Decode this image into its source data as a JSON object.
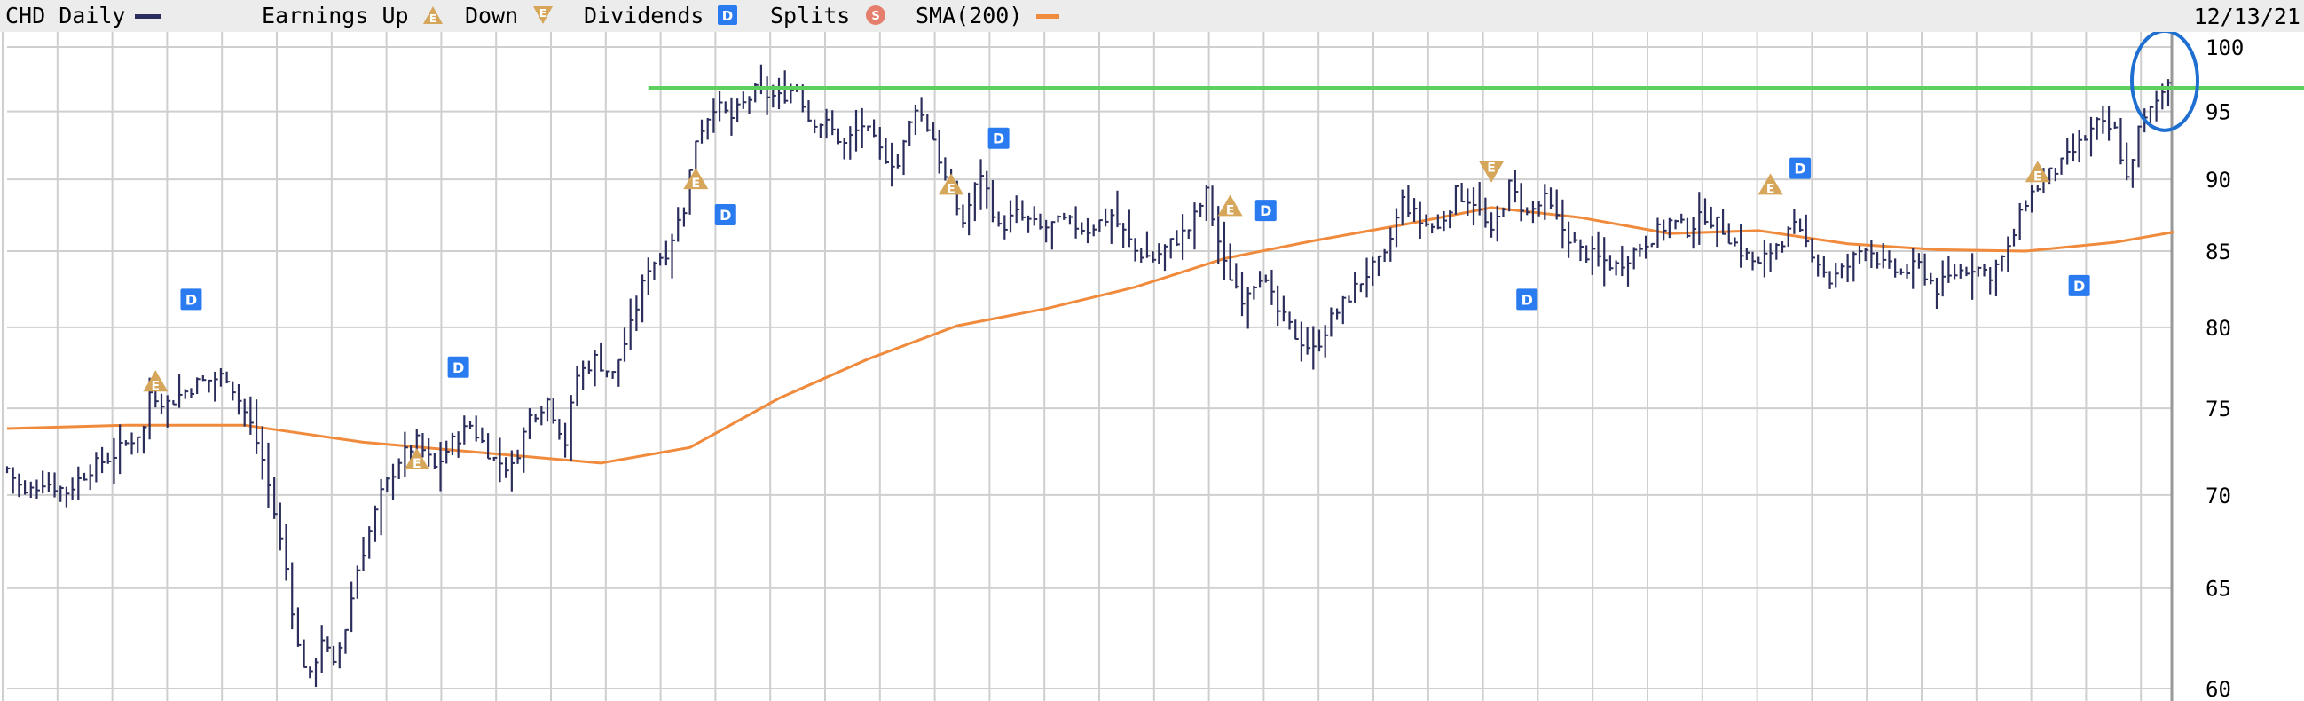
{
  "legend": {
    "symbol_label": "CHD Daily",
    "earnings_label": "Earnings Up",
    "earnings_up_glyph": "E",
    "down_label": "Down",
    "earnings_down_glyph": "E",
    "dividends_label": "Dividends",
    "dividend_glyph": "D",
    "splits_label": "Splits",
    "split_glyph": "S",
    "sma_label": "SMA(200)",
    "date": "12/13/21"
  },
  "colors": {
    "price": "#2b2e5c",
    "sma": "#f08a3c",
    "resistance": "#5ccf5c",
    "dividend": "#2a7bef",
    "earnings": "#d6a65a",
    "split": "#e57e6c",
    "highlight_circle": "#1f6fd0",
    "grid": "#cfcfcf"
  },
  "chart_data": {
    "type": "ohlc-bar",
    "symbol": "CHD",
    "interval": "Daily",
    "end_date": "12/13/21",
    "y_scale": "log",
    "ylim": [
      60,
      100
    ],
    "y_ticks": [
      "100",
      "95",
      "90",
      "85",
      "80",
      "75",
      "70",
      "65",
      "60"
    ],
    "grid": true,
    "price_path": [
      [
        0,
        71.5
      ],
      [
        3,
        70.0
      ],
      [
        6,
        70.8
      ],
      [
        10,
        70.2
      ],
      [
        14,
        71.5
      ],
      [
        18,
        72.3
      ],
      [
        23,
        73.8
      ],
      [
        24,
        76.0
      ],
      [
        27,
        75.3
      ],
      [
        32,
        76.5
      ],
      [
        37,
        77.0
      ],
      [
        41,
        74.0
      ],
      [
        43,
        72.0
      ],
      [
        45,
        69.0
      ],
      [
        47,
        66.0
      ],
      [
        49,
        62.0
      ],
      [
        51,
        60.5
      ],
      [
        53,
        62.5
      ],
      [
        55,
        61.0
      ],
      [
        57,
        63.0
      ],
      [
        59,
        66.0
      ],
      [
        61,
        68.0
      ],
      [
        63,
        70.0
      ],
      [
        66,
        72.0
      ],
      [
        69,
        73.0
      ],
      [
        72,
        71.5
      ],
      [
        75,
        73.0
      ],
      [
        78,
        74.0
      ],
      [
        82,
        72.0
      ],
      [
        85,
        71.5
      ],
      [
        88,
        74.5
      ],
      [
        91,
        75.5
      ],
      [
        94,
        73.0
      ],
      [
        96,
        77.0
      ],
      [
        99,
        78.0
      ],
      [
        102,
        77.0
      ],
      [
        105,
        80.0
      ],
      [
        108,
        84.0
      ],
      [
        111,
        85.0
      ],
      [
        114,
        88.0
      ],
      [
        116,
        93.0
      ],
      [
        119,
        95.5
      ],
      [
        122,
        94.5
      ],
      [
        126,
        96.5
      ],
      [
        130,
        96.0
      ],
      [
        133,
        97.0
      ],
      [
        135,
        94.5
      ],
      [
        138,
        94.0
      ],
      [
        141,
        92.5
      ],
      [
        144,
        94.0
      ],
      [
        147,
        92.0
      ],
      [
        150,
        91.0
      ],
      [
        153,
        95.5
      ],
      [
        156,
        93.0
      ],
      [
        158,
        90.0
      ],
      [
        161,
        87.0
      ],
      [
        164,
        90.5
      ],
      [
        167,
        86.5
      ],
      [
        170,
        87.5
      ],
      [
        174,
        86.5
      ],
      [
        178,
        87.0
      ],
      [
        182,
        86.5
      ],
      [
        186,
        87.5
      ],
      [
        190,
        85.0
      ],
      [
        193,
        84.5
      ],
      [
        196,
        85.5
      ],
      [
        199,
        86.5
      ],
      [
        202,
        89.0
      ],
      [
        205,
        84.0
      ],
      [
        208,
        82.0
      ],
      [
        211,
        83.5
      ],
      [
        214,
        81.0
      ],
      [
        217,
        79.5
      ],
      [
        220,
        78.5
      ],
      [
        223,
        80.5
      ],
      [
        226,
        82.0
      ],
      [
        229,
        83.5
      ],
      [
        232,
        84.5
      ],
      [
        235,
        88.5
      ],
      [
        238,
        87.0
      ],
      [
        241,
        86.5
      ],
      [
        244,
        89.0
      ],
      [
        247,
        88.5
      ],
      [
        250,
        86.0
      ],
      [
        253,
        89.5
      ],
      [
        256,
        87.5
      ],
      [
        259,
        88.5
      ],
      [
        262,
        86.5
      ],
      [
        265,
        85.0
      ],
      [
        268,
        84.5
      ],
      [
        271,
        84.0
      ],
      [
        274,
        85.0
      ],
      [
        277,
        86.0
      ],
      [
        280,
        87.0
      ],
      [
        283,
        86.5
      ],
      [
        286,
        87.5
      ],
      [
        289,
        86.5
      ],
      [
        292,
        85.0
      ],
      [
        295,
        84.0
      ],
      [
        298,
        85.5
      ],
      [
        301,
        86.5
      ],
      [
        304,
        85.0
      ],
      [
        307,
        83.0
      ],
      [
        310,
        84.0
      ],
      [
        313,
        85.5
      ],
      [
        316,
        84.0
      ],
      [
        319,
        83.5
      ],
      [
        322,
        84.0
      ],
      [
        325,
        82.5
      ],
      [
        328,
        83.5
      ],
      [
        331,
        84.0
      ],
      [
        334,
        83.5
      ],
      [
        337,
        85.0
      ],
      [
        340,
        88.5
      ],
      [
        343,
        90.0
      ],
      [
        346,
        91.0
      ],
      [
        349,
        92.5
      ],
      [
        352,
        94.0
      ],
      [
        355,
        93.5
      ],
      [
        357,
        90.0
      ],
      [
        359,
        93.5
      ],
      [
        361,
        95.0
      ],
      [
        363,
        96.5
      ],
      [
        364,
        97.5
      ]
    ],
    "sma_200": [
      [
        0,
        73.8
      ],
      [
        20,
        74.0
      ],
      [
        40,
        74.0
      ],
      [
        60,
        73.0
      ],
      [
        80,
        72.4
      ],
      [
        100,
        71.8
      ],
      [
        115,
        72.7
      ],
      [
        130,
        75.6
      ],
      [
        145,
        78.0
      ],
      [
        160,
        80.1
      ],
      [
        175,
        81.2
      ],
      [
        190,
        82.6
      ],
      [
        205,
        84.5
      ],
      [
        220,
        85.7
      ],
      [
        235,
        86.8
      ],
      [
        250,
        88.0
      ],
      [
        265,
        87.3
      ],
      [
        280,
        86.2
      ],
      [
        295,
        86.4
      ],
      [
        310,
        85.5
      ],
      [
        325,
        85.1
      ],
      [
        340,
        85.0
      ],
      [
        355,
        85.6
      ],
      [
        365,
        86.3
      ]
    ],
    "resistance_level": 96.8,
    "resistance_start": 108,
    "earnings_up": [
      [
        25,
        76.6
      ],
      [
        69,
        72.0
      ],
      [
        116,
        90.0
      ],
      [
        159,
        89.6
      ],
      [
        206,
        88.1
      ],
      [
        297,
        89.6
      ],
      [
        342,
        90.5
      ]
    ],
    "earnings_down": [
      [
        250,
        90.6
      ]
    ],
    "dividends": [
      [
        31,
        81.8
      ],
      [
        76,
        77.5
      ],
      [
        121,
        87.5
      ],
      [
        167,
        93.0
      ],
      [
        212,
        87.8
      ],
      [
        256,
        81.8
      ],
      [
        302,
        90.8
      ],
      [
        349,
        82.7
      ]
    ],
    "highlight": [
      364,
      97.5
    ],
    "trading_days": 365
  }
}
